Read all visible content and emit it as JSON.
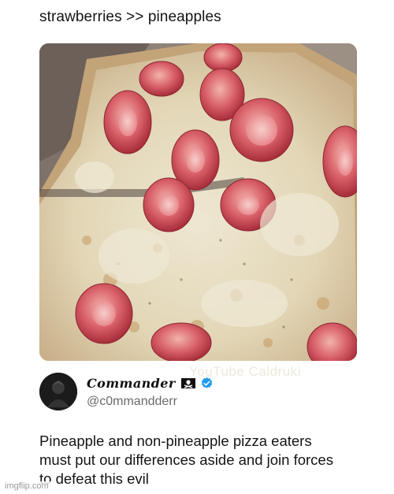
{
  "caption": "strawberries >> pineapples",
  "image_watermark": "YouTube Caldruki",
  "tweet": {
    "display_name": "Commander",
    "handle": "@c0mmandderr",
    "verified": true,
    "name_icons": [
      "pirate-flag-icon",
      "verified-badge-icon"
    ],
    "text_lines": [
      "Pineapple and non-pineapple pizza eaters",
      "must put our differences aside and join forces",
      "to defeat this evil"
    ]
  },
  "site_watermark": "imgflip.com",
  "colors": {
    "verified_badge": "#1d9bf0",
    "text": "#141414",
    "handle": "#6b6b6b"
  }
}
